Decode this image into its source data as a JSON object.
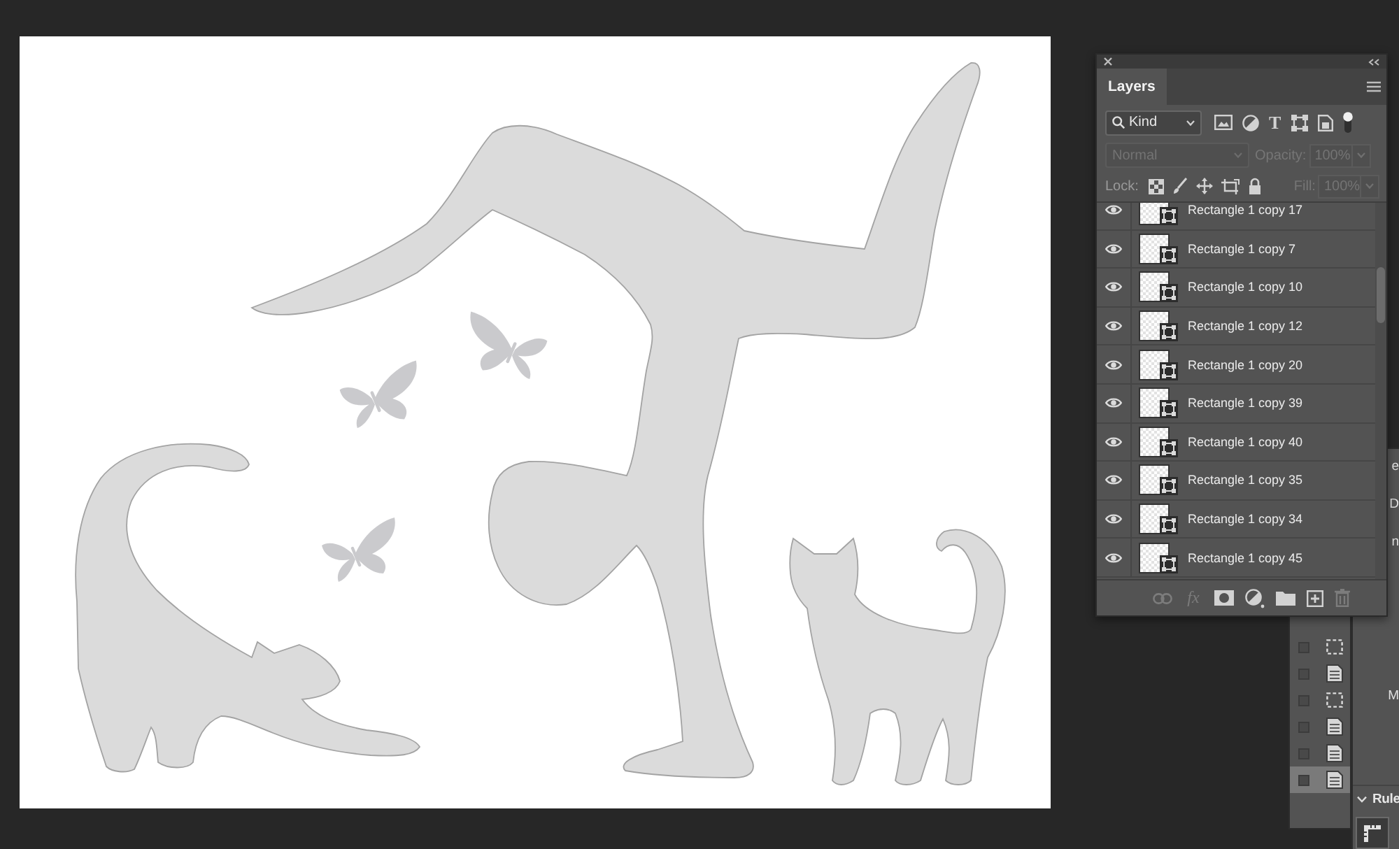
{
  "layers_panel": {
    "tabs": [
      {
        "label": "Layers",
        "selected": true
      }
    ],
    "filter": {
      "value": "Kind",
      "buttons": [
        {
          "kind": "pixel"
        },
        {
          "kind": "adjustment"
        },
        {
          "kind": "type",
          "label": "T"
        },
        {
          "kind": "shape"
        },
        {
          "kind": "smart_object"
        }
      ]
    },
    "blend_mode": {
      "value": "Normal",
      "disabled": true
    },
    "opacity": {
      "label": "Opacity:",
      "value": "100%",
      "disabled": true
    },
    "lock": {
      "label": "Lock:"
    },
    "fill": {
      "label": "Fill:",
      "value": "100%",
      "disabled": true
    },
    "layers": [
      {
        "name": "Rectangle 1 copy 17",
        "visible": true
      },
      {
        "name": "Rectangle 1 copy 7",
        "visible": true
      },
      {
        "name": "Rectangle 1 copy 10",
        "visible": true
      },
      {
        "name": "Rectangle 1 copy 12",
        "visible": true
      },
      {
        "name": "Rectangle 1 copy 20",
        "visible": true
      },
      {
        "name": "Rectangle 1 copy 39",
        "visible": true
      },
      {
        "name": "Rectangle 1 copy 40",
        "visible": true
      },
      {
        "name": "Rectangle 1 copy 35",
        "visible": true
      },
      {
        "name": "Rectangle 1 copy 34",
        "visible": true
      },
      {
        "name": "Rectangle 1 copy 45",
        "visible": true
      }
    ],
    "footer_buttons": [
      {
        "kind": "link",
        "disabled": true
      },
      {
        "kind": "effects",
        "label": "fx",
        "disabled": true
      },
      {
        "kind": "mask",
        "disabled": false
      },
      {
        "kind": "adjustment",
        "disabled": false
      },
      {
        "kind": "group",
        "disabled": false
      },
      {
        "kind": "new_layer",
        "disabled": false
      },
      {
        "kind": "delete",
        "disabled": true
      }
    ]
  },
  "history_panel": {
    "items": [
      {
        "kind": "selection",
        "checked": false,
        "selected": false
      },
      {
        "kind": "document",
        "checked": false,
        "selected": false
      },
      {
        "kind": "selection",
        "checked": false,
        "selected": false
      },
      {
        "kind": "document",
        "checked": false,
        "selected": false
      },
      {
        "kind": "document",
        "checked": false,
        "selected": false
      },
      {
        "kind": "document",
        "checked": false,
        "selected": true
      }
    ]
  },
  "properties_panel": {
    "fragments": [
      {
        "text": "e"
      },
      {
        "text": "D"
      },
      {
        "text": "n"
      },
      {
        "text": "M"
      }
    ],
    "section": {
      "title": "Rule",
      "expanded": true
    }
  }
}
